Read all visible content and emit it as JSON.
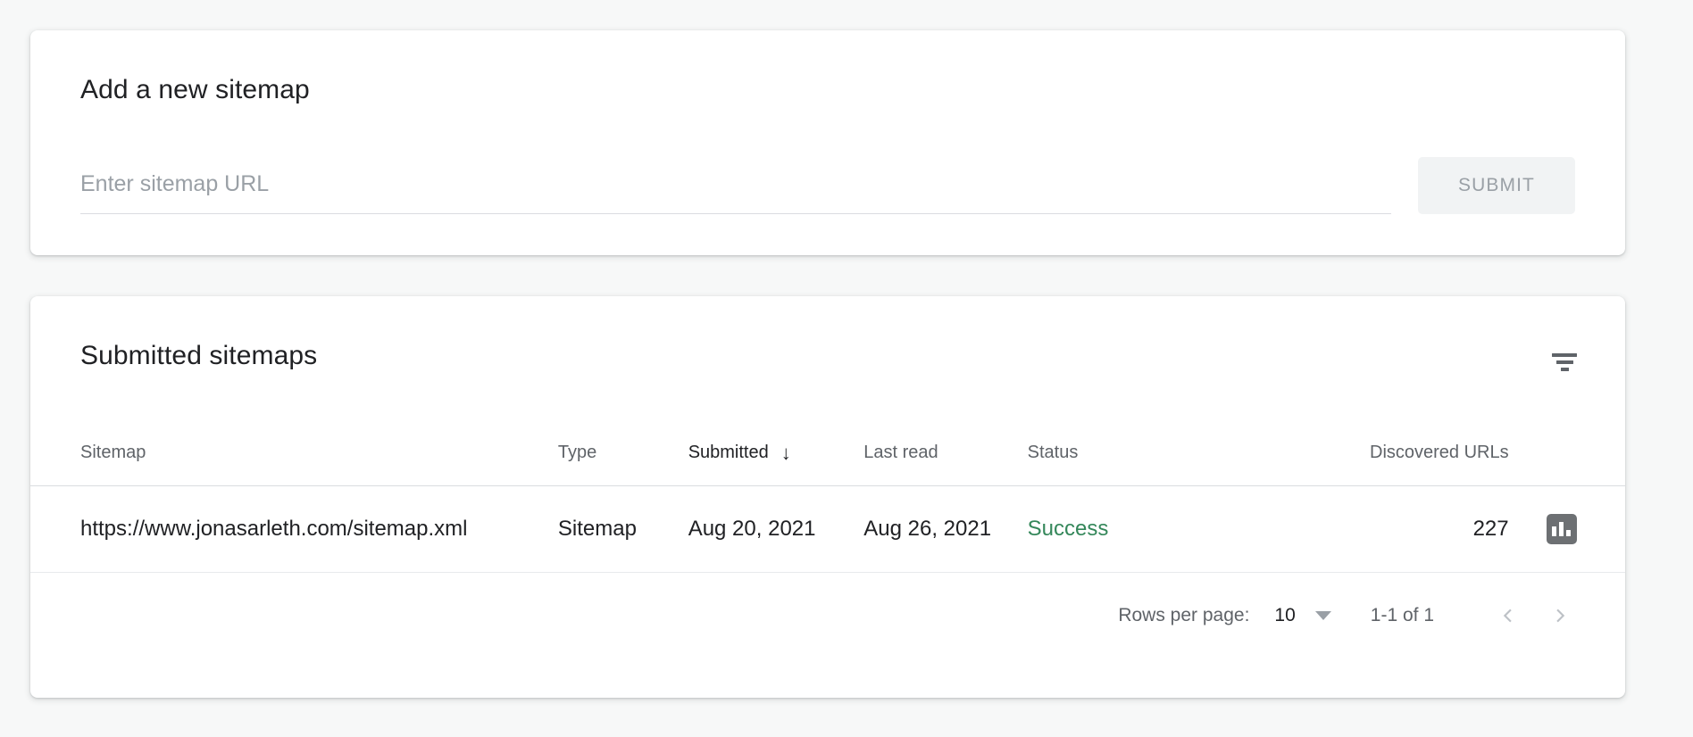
{
  "add_sitemap": {
    "title": "Add a new sitemap",
    "input_placeholder": "Enter sitemap URL",
    "input_value": "",
    "submit_label": "SUBMIT"
  },
  "submitted_sitemaps": {
    "title": "Submitted sitemaps",
    "filter_icon": "filter-icon",
    "columns": [
      {
        "key": "sitemap",
        "label": "Sitemap",
        "sorted": false
      },
      {
        "key": "type",
        "label": "Type",
        "sorted": false
      },
      {
        "key": "submitted",
        "label": "Submitted",
        "sorted": true,
        "sort_direction": "↓"
      },
      {
        "key": "last_read",
        "label": "Last read",
        "sorted": false
      },
      {
        "key": "status",
        "label": "Status",
        "sorted": false
      },
      {
        "key": "discovered_urls",
        "label": "Discovered URLs",
        "sorted": false
      }
    ],
    "rows": [
      {
        "sitemap": "https://www.jonasarleth.com/sitemap.xml",
        "type": "Sitemap",
        "submitted": "Aug 20, 2021",
        "last_read": "Aug 26, 2021",
        "status": "Success",
        "status_color": "#34875a",
        "discovered_urls": "227",
        "action_icon": "bar-chart-icon"
      }
    ],
    "pagination": {
      "rows_per_page_label": "Rows per page:",
      "rows_per_page_value": "10",
      "range_label": "1-1 of 1",
      "previous_icon": "chevron-left-icon",
      "next_icon": "chevron-right-icon"
    }
  },
  "theme": {
    "page_background": "#f7f8f8",
    "card_background": "#ffffff",
    "text_primary": "#202124",
    "text_secondary": "#5f6368",
    "text_muted": "#9aa0a6",
    "divider": "#dadce0",
    "success_green": "#34875a",
    "button_disabled_bg": "#f1f3f4",
    "icon_button_bg": "#6d7073"
  }
}
